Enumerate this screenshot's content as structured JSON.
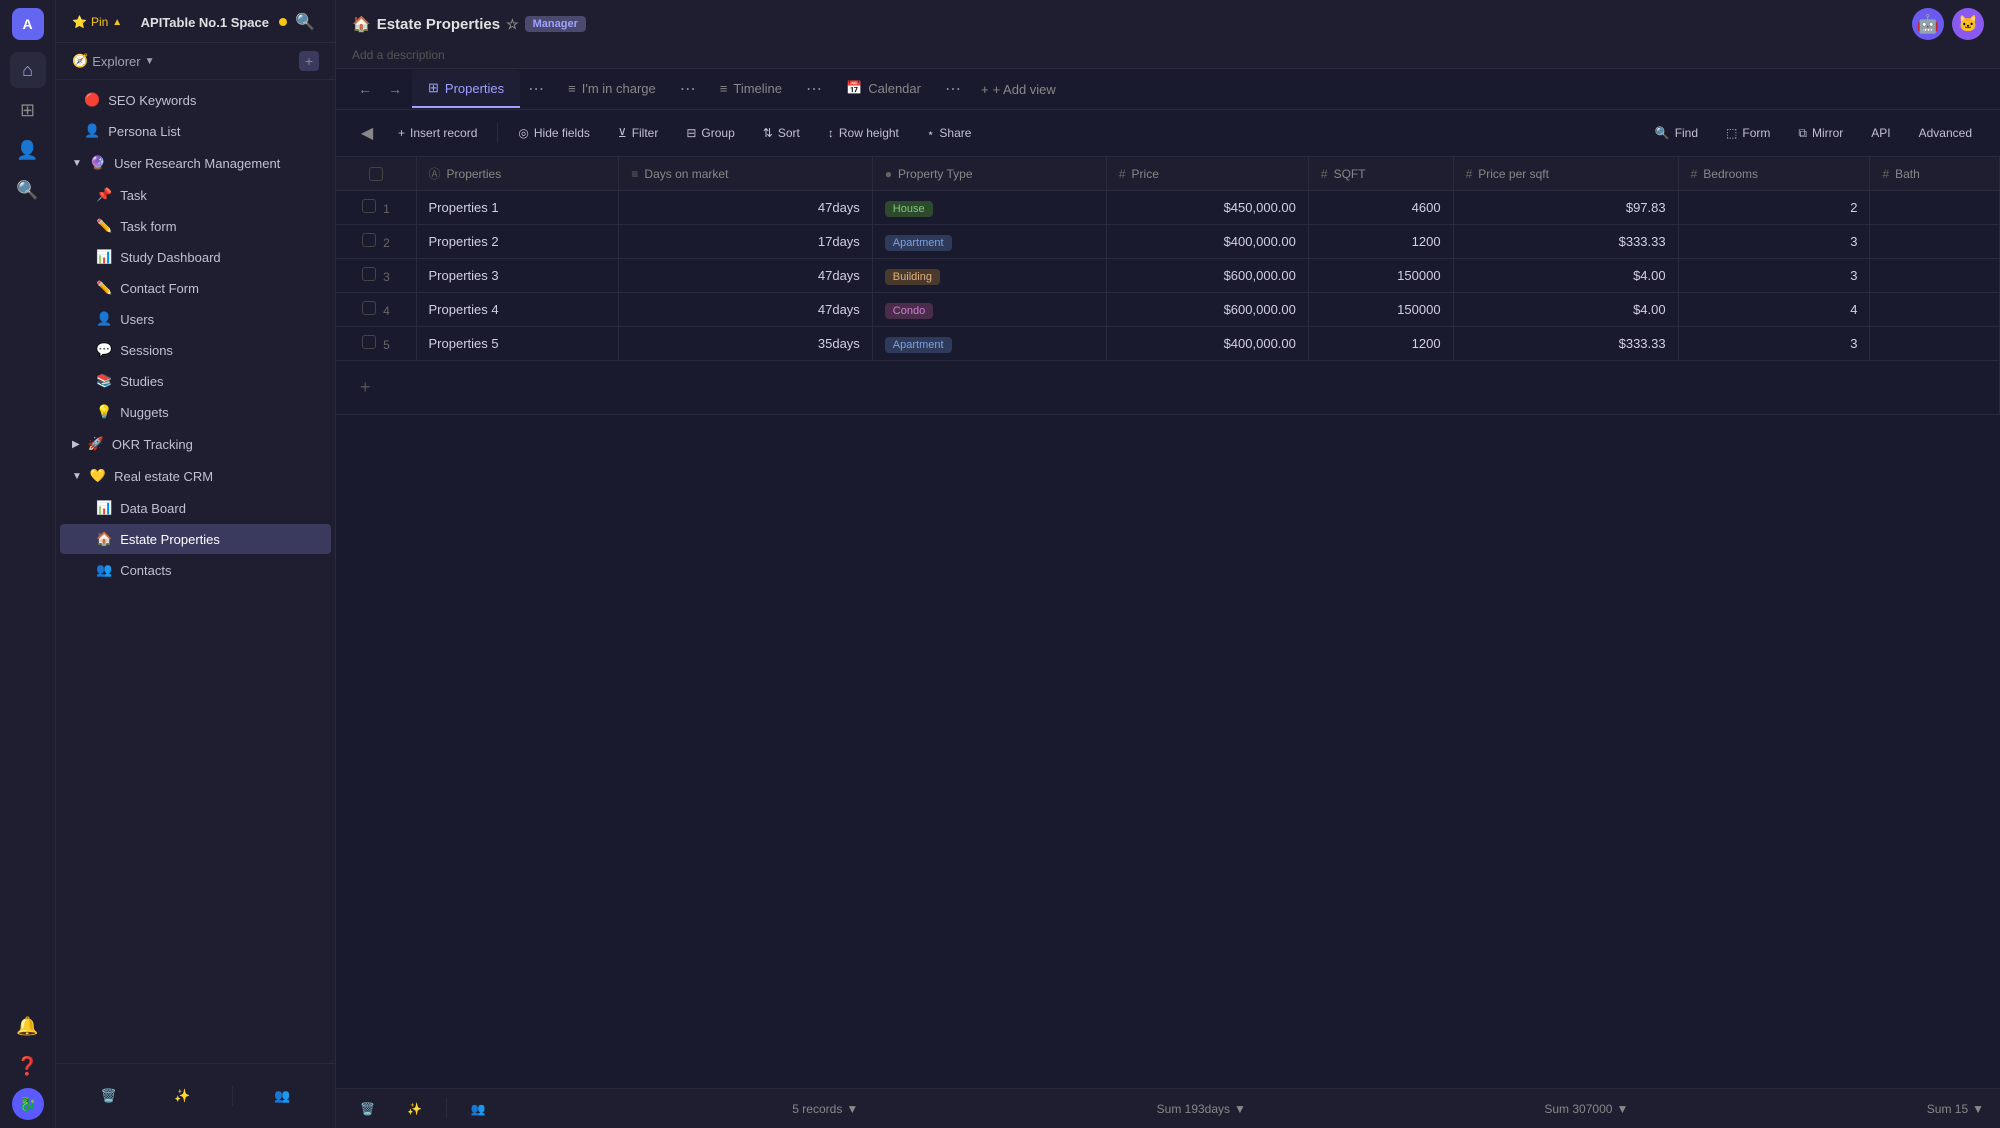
{
  "app": {
    "workspace_name": "APITable No.1 Space",
    "workspace_dot_color": "#f5c518"
  },
  "sidebar": {
    "pin_label": "Pin",
    "explorer_label": "Explorer",
    "items_top": [
      {
        "id": "seo-keywords",
        "icon": "🔴",
        "label": "SEO Keywords",
        "indent": 1
      },
      {
        "id": "persona-list",
        "icon": "👤",
        "label": "Persona List",
        "indent": 1
      }
    ],
    "group_user_research": {
      "icon": "🔮",
      "label": "User Research Management",
      "arrow": "▼"
    },
    "items_urm": [
      {
        "id": "task",
        "icon": "📌",
        "label": "Task",
        "indent": 2
      },
      {
        "id": "task-form",
        "icon": "✏️",
        "label": "Task form",
        "indent": 2
      },
      {
        "id": "study-dashboard",
        "icon": "📊",
        "label": "Study Dashboard",
        "indent": 2
      },
      {
        "id": "contact-form",
        "icon": "✏️",
        "label": "Contact Form",
        "indent": 2
      },
      {
        "id": "users",
        "icon": "👤",
        "label": "Users",
        "indent": 2
      },
      {
        "id": "sessions",
        "icon": "💬",
        "label": "Sessions",
        "indent": 2
      },
      {
        "id": "studies",
        "icon": "📚",
        "label": "Studies",
        "indent": 2
      },
      {
        "id": "nuggets",
        "icon": "💡",
        "label": "Nuggets",
        "indent": 2
      }
    ],
    "group_okr": {
      "icon": "🚀",
      "label": "OKR Tracking",
      "arrow": "▶"
    },
    "group_crm": {
      "icon": "💛",
      "label": "Real estate CRM",
      "arrow": "▼"
    },
    "items_crm": [
      {
        "id": "data-board",
        "icon": "📊",
        "label": "Data Board",
        "indent": 2
      },
      {
        "id": "estate-properties",
        "icon": "🏠",
        "label": "Estate Properties",
        "indent": 2,
        "active": true
      },
      {
        "id": "contacts",
        "icon": "👥",
        "label": "Contacts",
        "indent": 2
      }
    ],
    "bottom_items": [
      {
        "id": "notifications",
        "icon": "🔔"
      },
      {
        "id": "help",
        "icon": "❓"
      }
    ]
  },
  "header": {
    "title": "Estate Properties",
    "title_icon": "🏠",
    "manager_badge": "Manager",
    "description": "Add a description",
    "avatar1": "🤖",
    "avatar2": "🐱"
  },
  "view_tabs": [
    {
      "id": "properties",
      "icon": "⊞",
      "label": "Properties",
      "active": true
    },
    {
      "id": "im-in-charge",
      "icon": "≡",
      "label": "I'm in charge",
      "active": false
    },
    {
      "id": "timeline",
      "icon": "≡",
      "label": "Timeline",
      "active": false
    },
    {
      "id": "calendar",
      "icon": "📅",
      "label": "Calendar",
      "active": false
    }
  ],
  "add_view_label": "+ Add view",
  "toolbar": {
    "insert_record": "Insert record",
    "hide_fields": "Hide fields",
    "filter": "Filter",
    "group": "Group",
    "sort": "Sort",
    "row_height": "Row height",
    "share": "Share",
    "find": "Find",
    "form": "Form",
    "mirror": "Mirror",
    "api": "API",
    "advanced": "Advanced"
  },
  "table": {
    "columns": [
      {
        "id": "properties",
        "icon": "Ⓐ",
        "label": "Properties"
      },
      {
        "id": "days-on-market",
        "icon": "≡",
        "label": "Days on market"
      },
      {
        "id": "property-type",
        "icon": "●",
        "label": "Property Type"
      },
      {
        "id": "price",
        "icon": "#",
        "label": "Price"
      },
      {
        "id": "sqft",
        "icon": "#",
        "label": "SQFT"
      },
      {
        "id": "price-per-sqft",
        "icon": "#",
        "label": "Price per sqft"
      },
      {
        "id": "bedrooms",
        "icon": "#",
        "label": "Bedrooms"
      },
      {
        "id": "baths",
        "icon": "#",
        "label": "Bath"
      }
    ],
    "rows": [
      {
        "num": 1,
        "properties": "Properties 1",
        "days": "47days",
        "type": "House",
        "type_style": "house",
        "price": "$450,000.00",
        "sqft": "4600",
        "price_per_sqft": "$97.83",
        "bedrooms": "2"
      },
      {
        "num": 2,
        "properties": "Properties 2",
        "days": "17days",
        "type": "Apartment",
        "type_style": "apartment",
        "price": "$400,000.00",
        "sqft": "1200",
        "price_per_sqft": "$333.33",
        "bedrooms": "3"
      },
      {
        "num": 3,
        "properties": "Properties 3",
        "days": "47days",
        "type": "Building",
        "type_style": "building",
        "price": "$600,000.00",
        "sqft": "150000",
        "price_per_sqft": "$4.00",
        "bedrooms": "3"
      },
      {
        "num": 4,
        "properties": "Properties 4",
        "days": "47days",
        "type": "Condo",
        "type_style": "condo",
        "price": "$600,000.00",
        "sqft": "150000",
        "price_per_sqft": "$4.00",
        "bedrooms": "4"
      },
      {
        "num": 5,
        "properties": "Properties 5",
        "days": "35days",
        "type": "Apartment",
        "type_style": "apartment",
        "price": "$400,000.00",
        "sqft": "1200",
        "price_per_sqft": "$333.33",
        "bedrooms": "3"
      }
    ]
  },
  "bottom_bar": {
    "records_count": "5 records",
    "sum_days": "Sum 193days",
    "sum_sqft": "Sum 307000",
    "sum_bedrooms": "Sum 15",
    "delete_icon": "🗑",
    "magic_icon": "✨",
    "people_icon": "👥"
  }
}
